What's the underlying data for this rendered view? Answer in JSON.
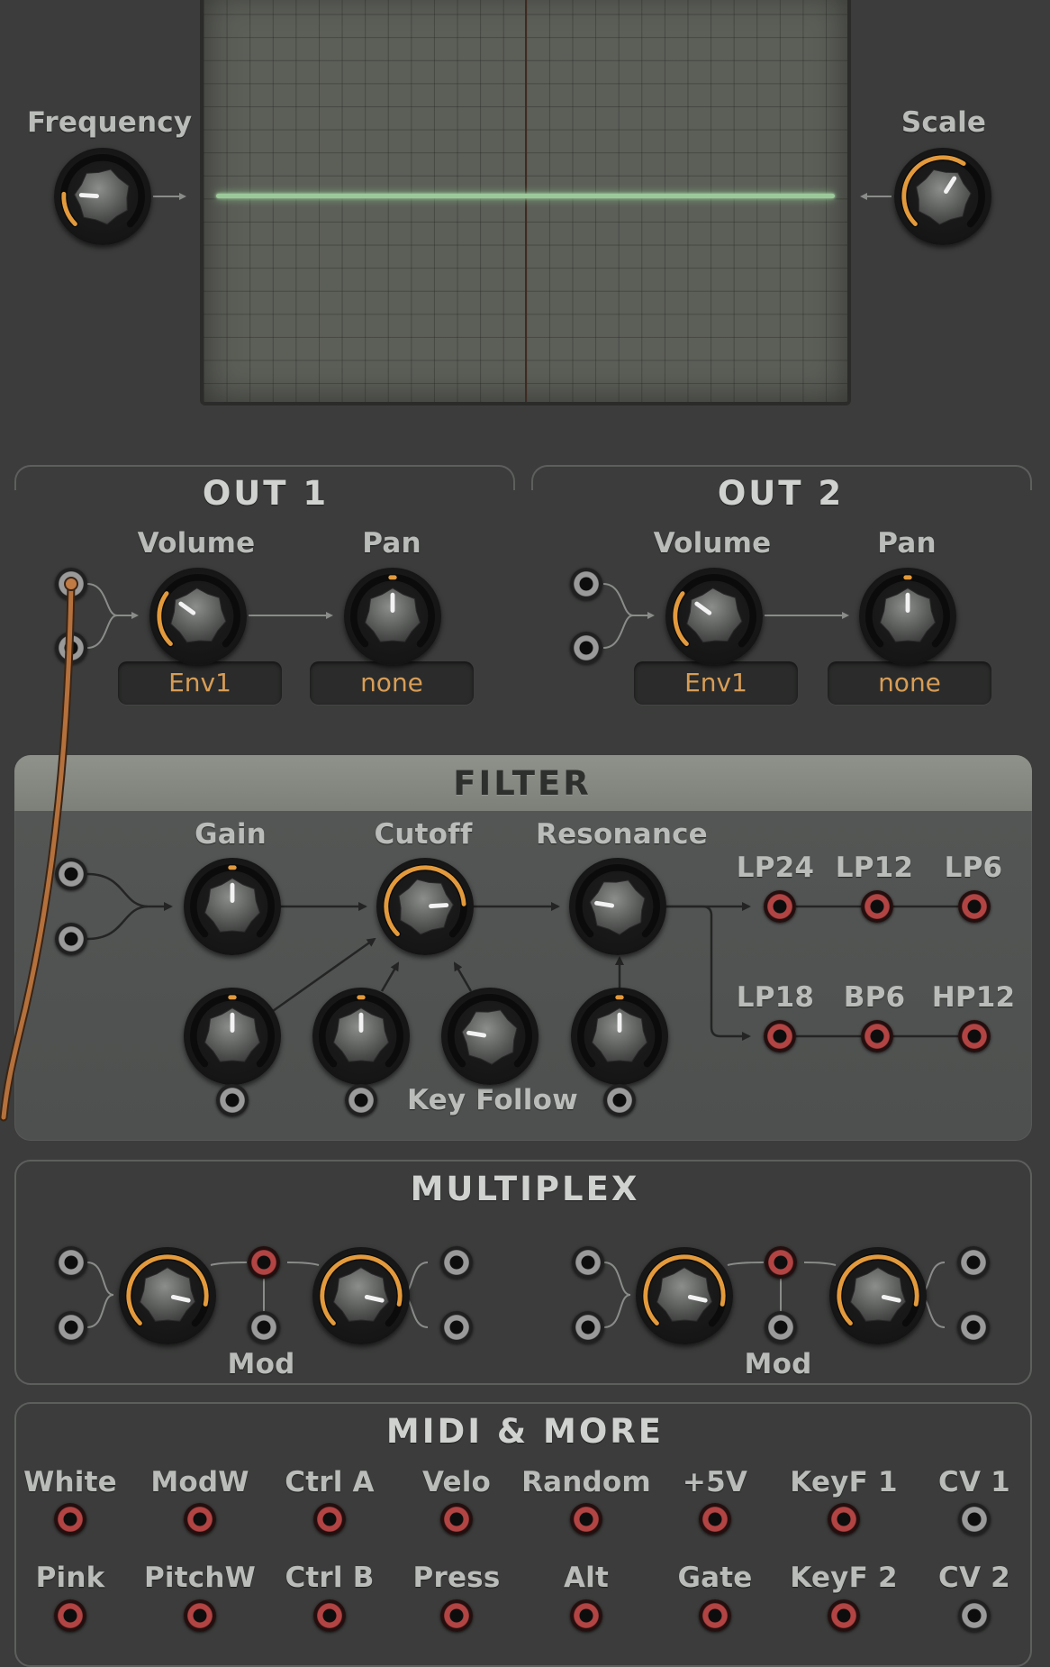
{
  "scope_panel": {
    "frequency_label": "Frequency",
    "scale_label": "Scale"
  },
  "out1": {
    "title": "OUT 1",
    "volume_label": "Volume",
    "pan_label": "Pan",
    "volume_mod": "Env1",
    "pan_mod": "none"
  },
  "out2": {
    "title": "OUT 2",
    "volume_label": "Volume",
    "pan_label": "Pan",
    "volume_mod": "Env1",
    "pan_mod": "none"
  },
  "filter": {
    "title": "FILTER",
    "gain_label": "Gain",
    "cutoff_label": "Cutoff",
    "resonance_label": "Resonance",
    "key_follow_label": "Key Follow",
    "outputs": [
      "LP24",
      "LP12",
      "LP6",
      "LP18",
      "BP6",
      "HP12"
    ]
  },
  "multiplex": {
    "title": "MULTIPLEX",
    "mod_label_1": "Mod",
    "mod_label_2": "Mod"
  },
  "midi": {
    "title": "MIDI & MORE",
    "row1": [
      "White",
      "ModW",
      "Ctrl A",
      "Velo",
      "Random",
      "+5V",
      "KeyF 1",
      "CV 1"
    ],
    "row2": [
      "Pink",
      "PitchW",
      "Ctrl B",
      "Press",
      "Alt",
      "Gate",
      "KeyF 2",
      "CV 2"
    ]
  },
  "colors": {
    "accent_orange": "#e39a3c",
    "panel_bg": "#3b3c3b",
    "filter_panel": "#555756",
    "jack_red": "#b24444",
    "trace_green": "#9cc99a",
    "cable": "#b4713d"
  }
}
